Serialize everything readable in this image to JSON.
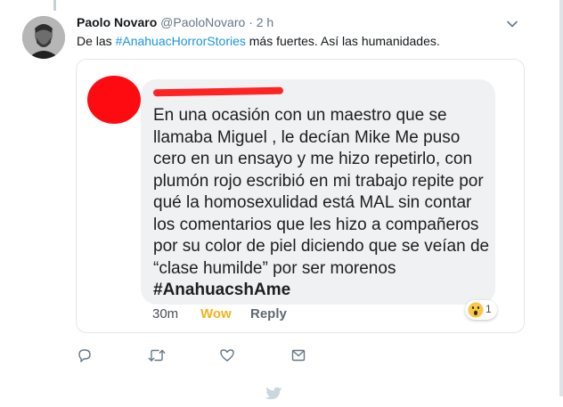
{
  "tweet": {
    "author_name": "Paolo Novaro",
    "handle": "@PaoloNovaro",
    "separator": "·",
    "time": "2 h",
    "text_before": "De las ",
    "hashtag": "#AnahuacHorrorStories",
    "text_after": " más fuertes. Así las humanidades."
  },
  "screenshot_card": {
    "comment_text": "En una ocasión con un maestro que se llamaba Miguel , le decían Mike  Me puso cero en un ensayo y me hizo repetirlo, con plumón rojo  escribió en mi trabajo repite por qué la homosexulidad está MAL  sin contar los comentarios que les hizo a compañeros por su color de piel diciendo que se veían de “clase humilde” por ser morenos ",
    "comment_hashtag": "#AnahuacshAme",
    "time": "30m",
    "wow_label": "Wow",
    "reply_label": "Reply",
    "reaction_count": "1",
    "reaction_icon": "wow-emoji-icon"
  },
  "actions": [
    "reply-icon",
    "retweet-icon",
    "like-icon",
    "message-icon"
  ],
  "colors": {
    "link": "#1b95e0",
    "redaction": "#fe0b12",
    "wow": "#f0b41c",
    "icon_gray": "#657786"
  }
}
